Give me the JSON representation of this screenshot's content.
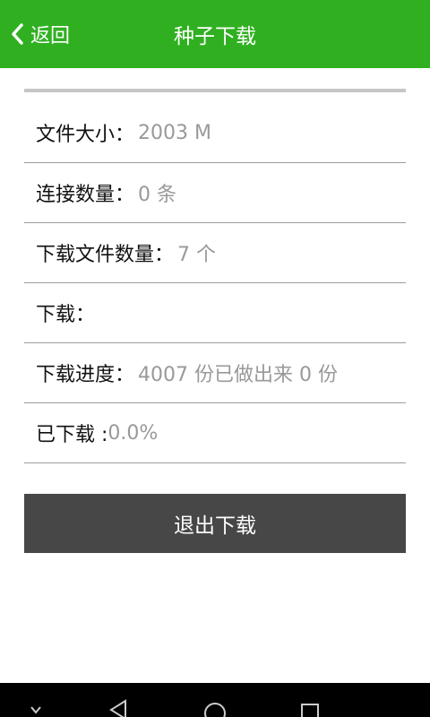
{
  "colors": {
    "header_bg": "#30b021",
    "button_bg": "#474747",
    "label_text": "#111111",
    "value_text": "#999999",
    "divider": "#9c9c9c",
    "navbar_bg": "#000000"
  },
  "header": {
    "back_label": "返回",
    "back_icon": "chevron-left-icon",
    "title": "种子下载"
  },
  "rows": [
    {
      "label": "文件大小：",
      "value": "2003 M"
    },
    {
      "label": "连接数量：",
      "value": "0 条"
    },
    {
      "label": "下载文件数量：",
      "value": "7 个"
    },
    {
      "label": "下载：",
      "value": ""
    },
    {
      "label": "下载进度：",
      "value": "4007 份已做出来 0 份"
    },
    {
      "label": "已下载 :",
      "value": "0.0%"
    }
  ],
  "exit_button": {
    "label": "退出下载"
  },
  "navbar": {
    "icons": [
      "chevron-down-icon",
      "back-triangle-icon",
      "home-circle-icon",
      "recents-square-icon"
    ]
  }
}
